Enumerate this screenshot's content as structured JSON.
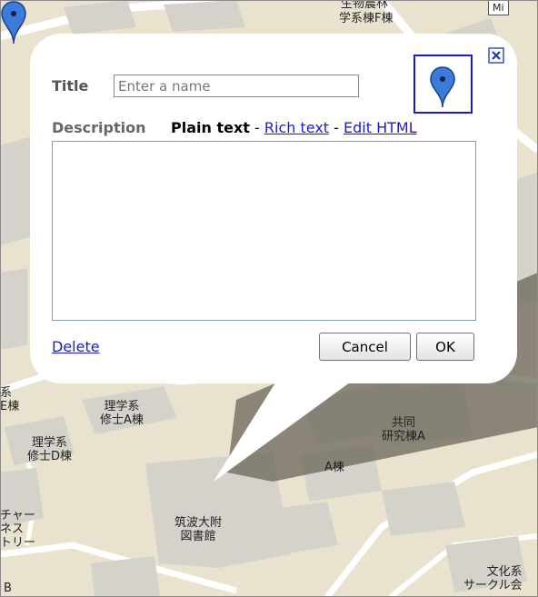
{
  "map": {
    "labels": {
      "top_building": "学系棟F棟",
      "top_partial": "生物農林",
      "top_right": "Mi",
      "left_edge_1": "系",
      "left_edge_2": "E棟",
      "science_a": "理学系\n修士A棟",
      "science_d": "理学系\n修士D棟",
      "left_bottom": "チャー\nネス\nトリー",
      "joint_research": "共同\n研究棟A",
      "a_building": "A棟",
      "library": "筑波大附\n図書館",
      "bottom_right": "文化系\nサークル会",
      "bottom_left": "B"
    },
    "colors": {
      "land": "#e9e2cf",
      "building": "#d5d2cb",
      "road": "#ffffff",
      "shadow": "#6a6658"
    }
  },
  "dialog": {
    "title_label": "Title",
    "title_placeholder": "Enter a name",
    "title_value": "",
    "icon_name": "blue-placemark-icon",
    "close_icon": "close-icon",
    "description_label": "Description",
    "modes": {
      "plain_text": "Plain text",
      "separator": "-",
      "rich_text": "Rich text",
      "edit_html": "Edit HTML"
    },
    "description_value": "",
    "delete_label": "Delete",
    "cancel_label": "Cancel",
    "ok_label": "OK"
  },
  "colors": {
    "link": "#1b1bd3",
    "marker": "#3d7bd8",
    "icon_border": "#1a1ad6"
  }
}
